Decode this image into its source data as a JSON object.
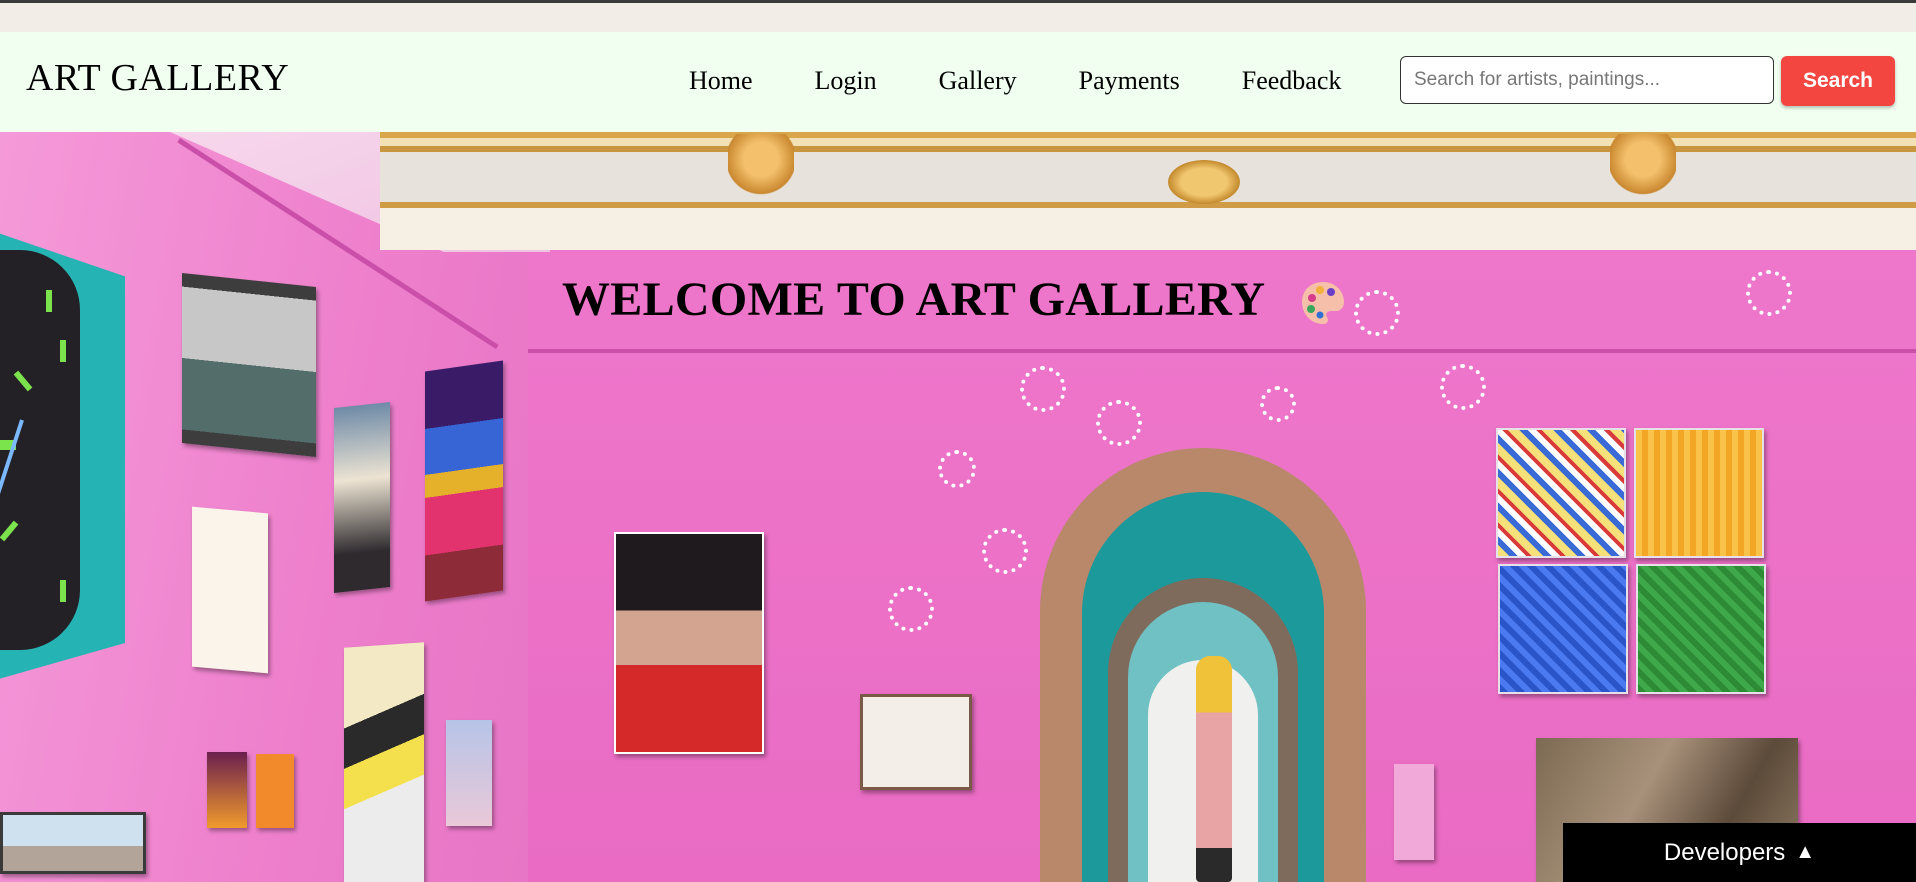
{
  "brand": {
    "title": "ART GALLERY"
  },
  "nav": {
    "items": [
      {
        "label": "Home"
      },
      {
        "label": "Login"
      },
      {
        "label": "Gallery"
      },
      {
        "label": "Payments"
      },
      {
        "label": "Feedback"
      }
    ]
  },
  "search": {
    "placeholder": "Search for artists, paintings...",
    "value": "",
    "button_label": "Search"
  },
  "hero": {
    "title": "WELCOME TO ART GALLERY",
    "icon": "artist-palette-icon"
  },
  "developers": {
    "label": "Developers",
    "arrow": "▲"
  },
  "colors": {
    "navbar_bg": "#f0fff0",
    "search_button": "#f44640",
    "wall_pink": "#e96bc3",
    "dev_bar_bg": "#000000"
  }
}
